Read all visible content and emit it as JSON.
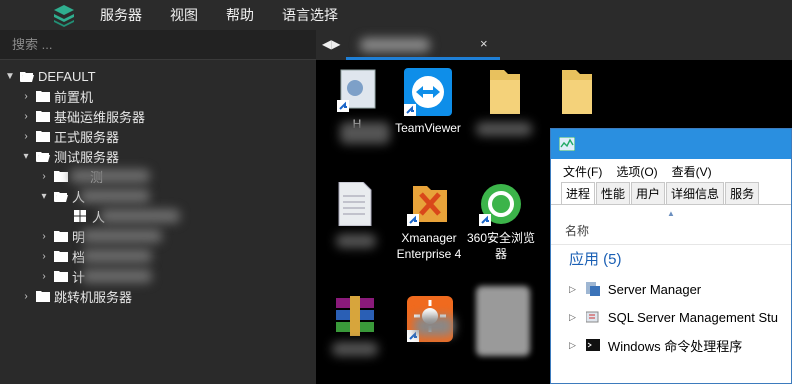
{
  "menubar": {
    "items": [
      "服务器",
      "视图",
      "帮助",
      "语言选择"
    ]
  },
  "search": {
    "placeholder": "搜索 ..."
  },
  "tree": {
    "root": "DEFAULT",
    "items": [
      {
        "label": "前置机"
      },
      {
        "label": "基础运维服务器"
      },
      {
        "label": "正式服务器"
      },
      {
        "label": "测试服务器"
      },
      {
        "label": "测"
      },
      {
        "label": "人"
      },
      {
        "label": "人"
      },
      {
        "label": "明"
      },
      {
        "label": "档"
      },
      {
        "label": "计"
      },
      {
        "label": "跳转机服务器"
      }
    ]
  },
  "tab": {
    "nav": "◀▶",
    "close": "×"
  },
  "desktop": {
    "icons": [
      {
        "label": "H"
      },
      {
        "label": "TeamViewer"
      },
      {
        "label": "Xmanager Enterprise 4"
      },
      {
        "label": "360安全浏览器"
      }
    ]
  },
  "taskmanager": {
    "menu": [
      "文件(F)",
      "选项(O)",
      "查看(V)"
    ],
    "tabs": [
      "进程",
      "性能",
      "用户",
      "详细信息",
      "服务"
    ],
    "column": "名称",
    "group": "应用 (5)",
    "rows": [
      "Server Manager",
      "SQL Server Management Stu",
      "Windows 命令处理程序"
    ]
  },
  "colors": {
    "accent": "#1e7fd6",
    "sidebar": "#2a2a2a",
    "titlebar": "#2a8fe0"
  }
}
